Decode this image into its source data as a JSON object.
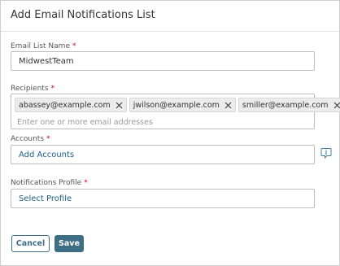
{
  "dialog": {
    "title": "Add Email Notifications List"
  },
  "email_list_name": {
    "label": "Email List Name",
    "required_mark": "*",
    "value": "MidwestTeam"
  },
  "recipients": {
    "label": "Recipients",
    "required_mark": "*",
    "chips": [
      "abassey@example.com",
      "jwilson@example.com",
      "smiller@example.com"
    ],
    "placeholder": "Enter one or more email addresses"
  },
  "accounts": {
    "label": "Accounts",
    "required_mark": "*",
    "value": "Add Accounts",
    "info_icon": "info-icon"
  },
  "notifications_profile": {
    "label": "Notifications Profile",
    "required_mark": "*",
    "value": "Select Profile"
  },
  "buttons": {
    "cancel": "Cancel",
    "save": "Save"
  },
  "colors": {
    "primary": "#3d6e86",
    "link": "#1b5e84",
    "required": "#d0021b"
  }
}
